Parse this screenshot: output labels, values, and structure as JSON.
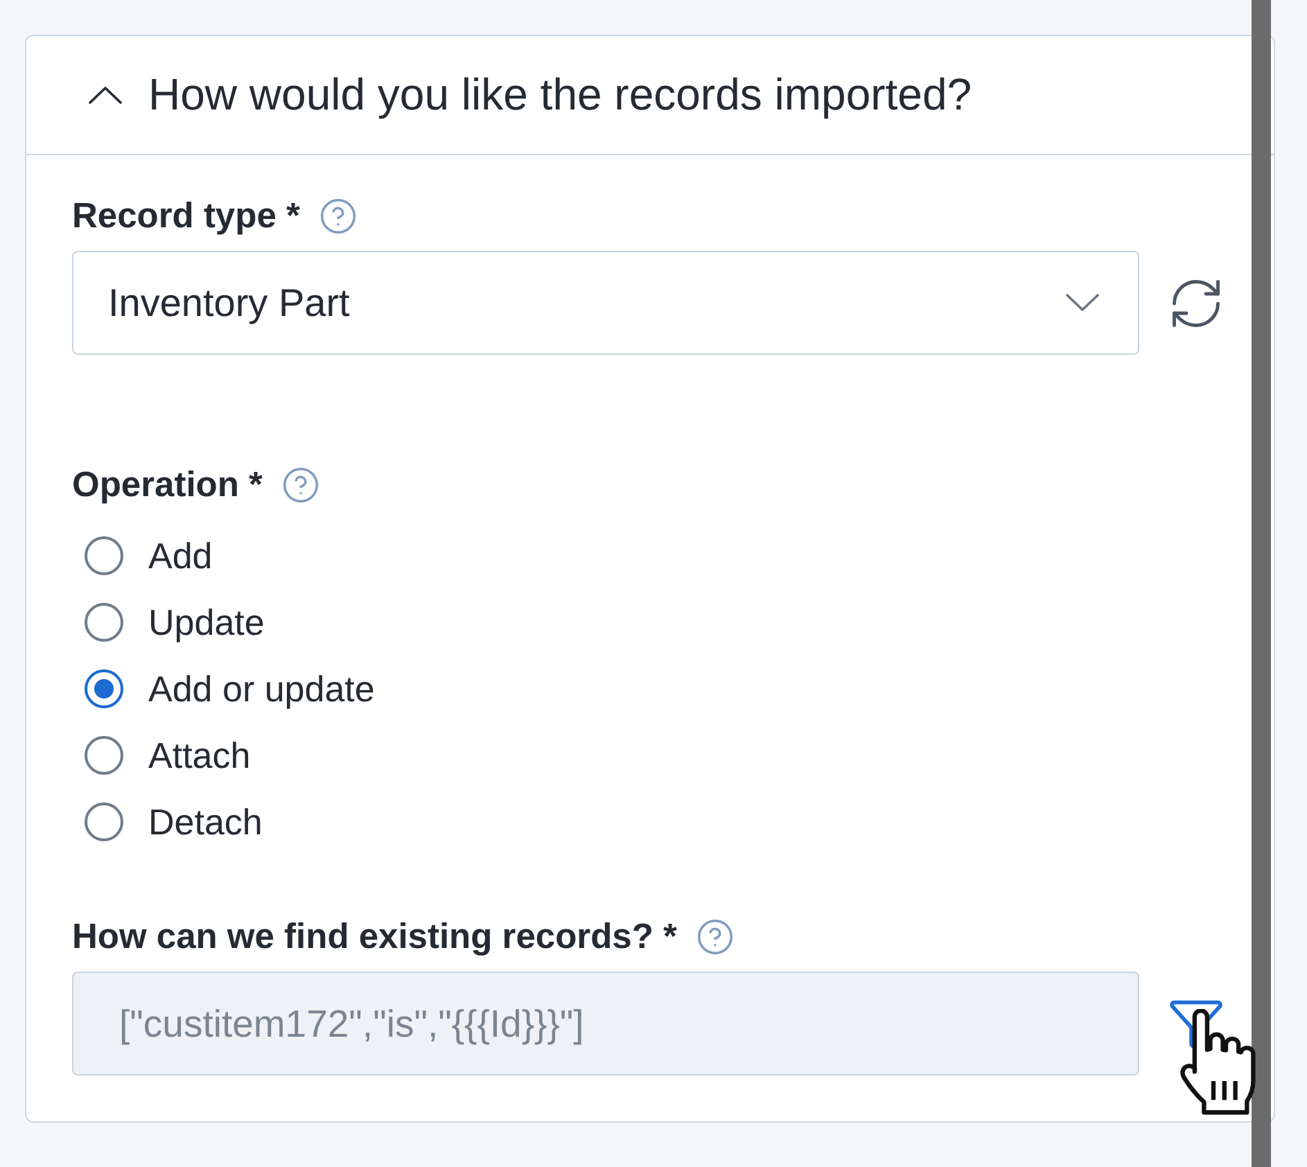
{
  "section": {
    "title": "How would you like the records imported?",
    "expanded": true
  },
  "record_type": {
    "label": "Record type *",
    "value": "Inventory Part"
  },
  "operation": {
    "label": "Operation *",
    "options": [
      {
        "label": "Add",
        "selected": false
      },
      {
        "label": "Update",
        "selected": false
      },
      {
        "label": "Add or update",
        "selected": true
      },
      {
        "label": "Attach",
        "selected": false
      },
      {
        "label": "Detach",
        "selected": false
      }
    ]
  },
  "lookup": {
    "label": "How can we find existing records? *",
    "value": "[\"custitem172\",\"is\",\"{{{Id}}}\"]",
    "disabled": true
  }
}
